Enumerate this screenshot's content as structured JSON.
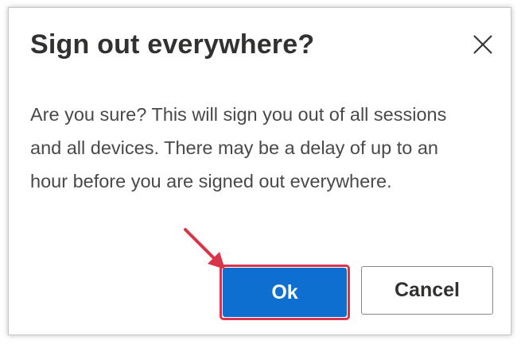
{
  "dialog": {
    "title": "Sign out everywhere?",
    "message": "Are you sure? This will sign you out of all sessions and all devices. There may be a delay of up to an hour before you are signed out everywhere.",
    "ok_label": "Ok",
    "cancel_label": "Cancel"
  },
  "icons": {
    "close": "close-icon",
    "annotation": "arrow-icon"
  },
  "colors": {
    "primary_button": "#0e6fd0",
    "annotation": "#d8344a"
  }
}
